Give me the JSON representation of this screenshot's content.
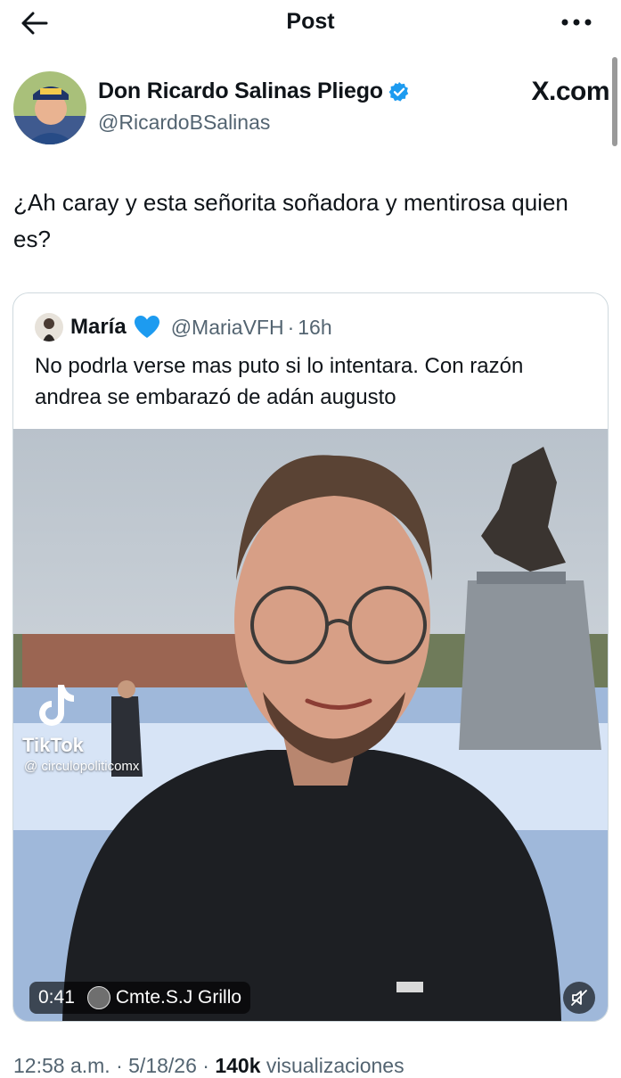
{
  "header": {
    "title": "Post",
    "back_icon": "arrow-left-icon",
    "more_icon": "more-icon"
  },
  "author": {
    "name": "Don Ricardo Salinas Pliego",
    "handle": "@RicardoBSalinas",
    "verified_color": "#1d9bf0",
    "watermark": "X.com"
  },
  "tweet": {
    "text": "¿Ah caray y esta señorita soñadora y mentirosa quien es?"
  },
  "quoted": {
    "name": "María",
    "handle": "@MariaVFH",
    "separator": "·",
    "time": "16h",
    "heart_color": "#1d9bf0",
    "text": "No podrla verse mas puto si lo intentara. Con razón andrea se embarazó de adán augusto",
    "video": {
      "tiktok_label": "TikTok",
      "tiktok_user": "@ circulopoliticomx",
      "duration": "0:41",
      "channel": "Cmte.S.J Grillo",
      "mute_icon": "muted-speaker-icon"
    }
  },
  "meta": {
    "time": "12:58 a.m.",
    "separator": "·",
    "date": "5/18/26",
    "views_count": "140k",
    "views_label": "visualizaciones"
  }
}
